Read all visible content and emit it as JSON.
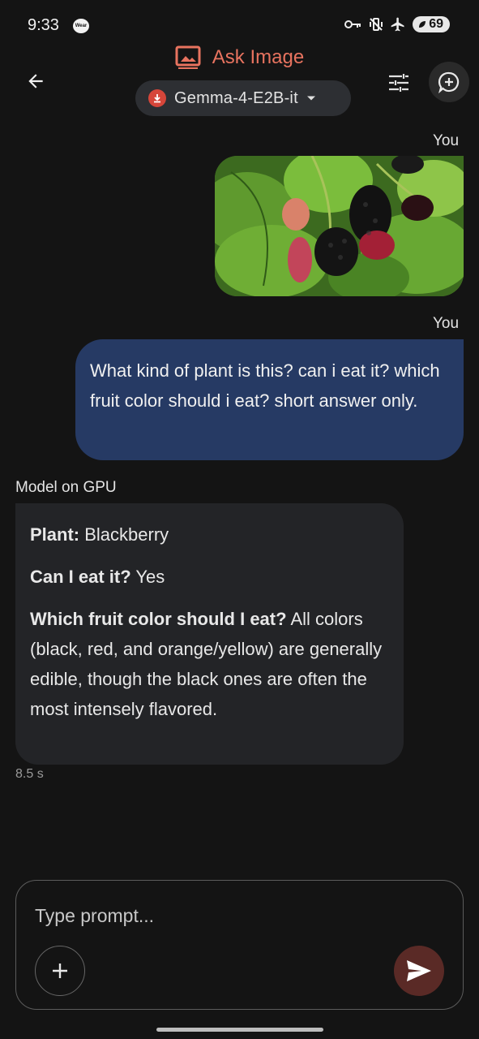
{
  "status_bar": {
    "time": "9:33",
    "wear_label": "Wear",
    "battery": "69"
  },
  "header": {
    "title": "Ask Image",
    "model_name": "Gemma-4-E2B-it",
    "accent_color": "#e8735f"
  },
  "messages": {
    "user_image_sender": "You",
    "user_text_sender": "You",
    "user_text": "What kind of plant is this? can i eat it? which fruit color should i eat? short answer only.",
    "model_sender": "Model on GPU",
    "answer": {
      "plant_label": "Plant:",
      "plant_value": " Blackberry",
      "eat_label": "Can I eat it?",
      "eat_value": " Yes",
      "color_label": "Which fruit color should I eat?",
      "color_value": " All colors (black, red, and orange/yellow) are generally edible, though the black ones are often the most intensely flavored."
    },
    "latency": "8.5 s"
  },
  "composer": {
    "placeholder": "Type prompt..."
  },
  "colors": {
    "user_bubble": "#263a64",
    "model_bubble": "#232427",
    "send_button": "#5a2a26"
  }
}
